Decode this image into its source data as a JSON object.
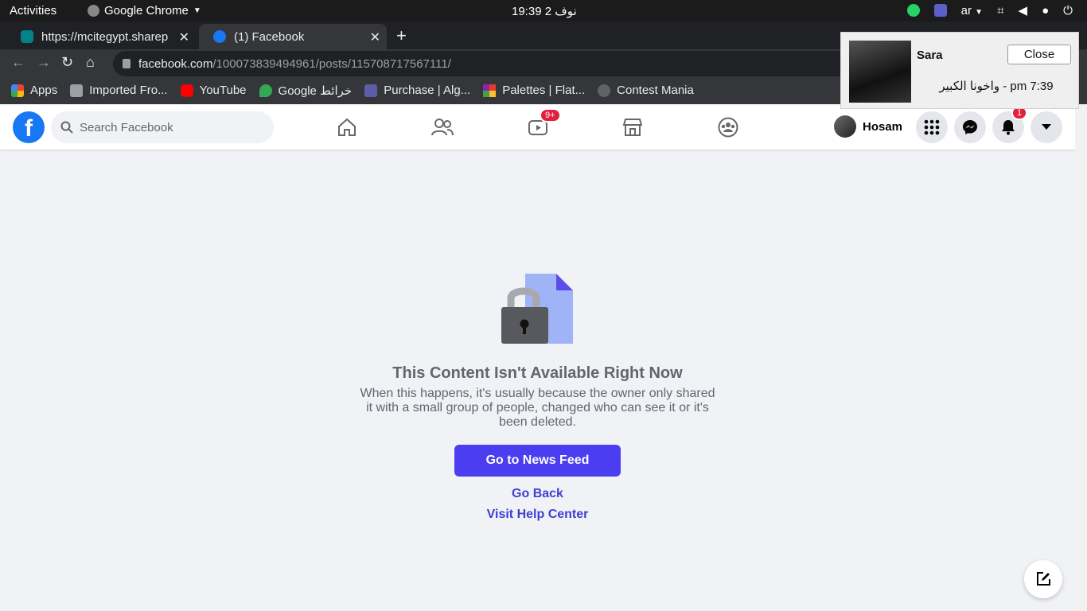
{
  "system": {
    "activities": "Activities",
    "app_name": "Google Chrome",
    "clock": "نوف 2  19:39",
    "lang": "ar"
  },
  "tabs": [
    {
      "title": "https://mcitegypt.sharep",
      "active": false
    },
    {
      "title": "(1) Facebook",
      "active": true
    }
  ],
  "address": {
    "host": "facebook.com",
    "path": "/100073839494961/posts/115708717567111/"
  },
  "bookmarks": [
    {
      "label": "Apps",
      "icon": "apps-grid-icon",
      "color": "#ea4335"
    },
    {
      "label": "Imported Fro...",
      "icon": "folder-icon",
      "color": "#9aa0a6"
    },
    {
      "label": "YouTube",
      "icon": "youtube-icon",
      "color": "#ff0000"
    },
    {
      "label": "Google خرائط",
      "icon": "maps-pin-icon",
      "color": "#34a853"
    },
    {
      "label": "Purchase | Alg...",
      "icon": "algo-icon",
      "color": "#5b5ea6"
    },
    {
      "label": "Palettes | Flat...",
      "icon": "palette-icon",
      "color": "#f9a825"
    },
    {
      "label": "Contest Mania",
      "icon": "code-icon",
      "color": "#9aa0a6"
    }
  ],
  "fb": {
    "search_placeholder": "Search Facebook",
    "watch_badge": "9+",
    "notif_badge": "1",
    "profile_name": "Hosam",
    "brand_color": "#1877f2"
  },
  "error": {
    "title": "This Content Isn't Available Right Now",
    "description": "When this happens, it's usually because the owner only shared it with a small group of people, changed who can see it or it's been deleted.",
    "primary_button": "Go to News Feed",
    "go_back": "Go Back",
    "help_center": "Visit Help Center"
  },
  "notification": {
    "sender": "Sara",
    "close_label": "Close",
    "message": "7:39 pm - واخونا الكبير"
  }
}
